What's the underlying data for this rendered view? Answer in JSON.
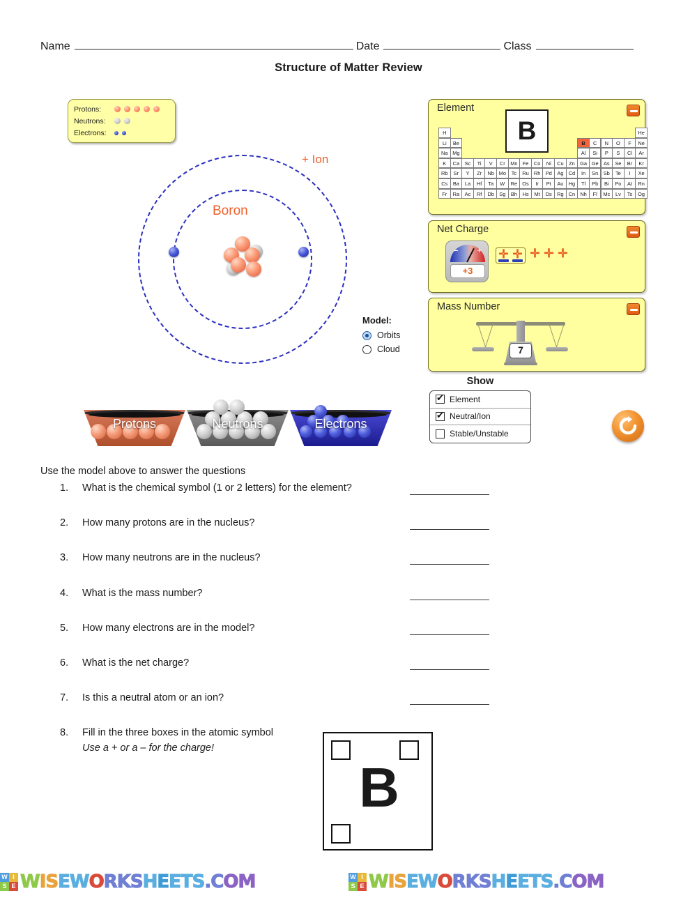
{
  "header": {
    "name_label": "Name",
    "date_label": "Date",
    "class_label": "Class",
    "title": "Structure of Matter Review"
  },
  "legend": {
    "protons_label": "Protons:",
    "neutrons_label": "Neutrons:",
    "electrons_label": "Electrons:",
    "protons_count": 5,
    "neutrons_count": 2,
    "electrons_count": 2
  },
  "atom": {
    "element_name": "Boron",
    "ion_label": "+ Ion",
    "nucleus_protons": 5,
    "nucleus_neutrons": 2,
    "orbit_electrons": 2,
    "accent_color": "#f0612c",
    "orbit_color": "#2b2fbe"
  },
  "model": {
    "title": "Model:",
    "options": [
      {
        "label": "Orbits",
        "selected": true
      },
      {
        "label": "Cloud",
        "selected": false
      }
    ]
  },
  "buckets": [
    {
      "label": "Protons",
      "color": "#c4603c"
    },
    {
      "label": "Neutrons",
      "color": "#6e6e6e"
    },
    {
      "label": "Electrons",
      "color": "#2b2bb4"
    }
  ],
  "panels": {
    "element": {
      "title": "Element",
      "symbol": "B",
      "highlighted": "B",
      "rows": [
        [
          "H",
          "",
          "",
          "",
          "",
          "",
          "",
          "",
          "",
          "",
          "",
          "",
          "",
          "",
          "",
          "",
          "",
          "He"
        ],
        [
          "Li",
          "Be",
          "",
          "",
          "",
          "",
          "",
          "",
          "",
          "",
          "",
          "",
          "B",
          "C",
          "N",
          "O",
          "F",
          "Ne"
        ],
        [
          "Na",
          "Mg",
          "",
          "",
          "",
          "",
          "",
          "",
          "",
          "",
          "",
          "",
          "Al",
          "Si",
          "P",
          "S",
          "Cl",
          "Ar"
        ],
        [
          "K",
          "Ca",
          "Sc",
          "Ti",
          "V",
          "Cr",
          "Mn",
          "Fe",
          "Co",
          "Ni",
          "Cu",
          "Zn",
          "Ga",
          "Ge",
          "As",
          "Se",
          "Br",
          "Kr"
        ],
        [
          "Rb",
          "Sr",
          "Y",
          "Zr",
          "Nb",
          "Mo",
          "Tc",
          "Ru",
          "Rh",
          "Pd",
          "Ag",
          "Cd",
          "In",
          "Sn",
          "Sb",
          "Te",
          "I",
          "Xe"
        ],
        [
          "Cs",
          "Ba",
          "La",
          "Hf",
          "Ta",
          "W",
          "Re",
          "Os",
          "Ir",
          "Pt",
          "Au",
          "Hg",
          "Tl",
          "Pb",
          "Bi",
          "Po",
          "At",
          "Rn"
        ],
        [
          "Fr",
          "Ra",
          "Ac",
          "Rf",
          "Db",
          "Sg",
          "Bh",
          "Hs",
          "Mt",
          "Ds",
          "Rg",
          "Cn",
          "Nh",
          "Fl",
          "Mc",
          "Lv",
          "Ts",
          "Og"
        ]
      ]
    },
    "net_charge": {
      "title": "Net Charge",
      "value": "+3",
      "gauge_minus": "−",
      "gauge_plus": "+",
      "total_plus": 5,
      "paired_plus": 2
    },
    "mass_number": {
      "title": "Mass Number",
      "value": "7"
    }
  },
  "show": {
    "title": "Show",
    "items": [
      {
        "label": "Element",
        "checked": true
      },
      {
        "label": "Neutral/Ion",
        "checked": true
      },
      {
        "label": "Stable/Unstable",
        "checked": false
      }
    ]
  },
  "questions": {
    "intro": "Use the model above to answer the questions",
    "items": [
      {
        "num": "1.",
        "text": "What is the chemical symbol (1 or 2 letters) for the element?"
      },
      {
        "num": "2.",
        "text": "How many protons are in the nucleus?"
      },
      {
        "num": "3.",
        "text": "How many neutrons are in the nucleus?"
      },
      {
        "num": "4.",
        "text": "What is the mass number?"
      },
      {
        "num": "5.",
        "text": "How many electrons are in the model?"
      },
      {
        "num": "6.",
        "text": "What is the net charge?"
      },
      {
        "num": "7.",
        "text": "Is this a neutral atom or an ion?"
      },
      {
        "num": "8.",
        "text": "Fill in the three boxes in the atomic symbol",
        "italic": "Use a + or a – for the charge!"
      }
    ]
  },
  "atomic_symbol": {
    "letter": "B"
  },
  "watermark": {
    "logo_letters": [
      "W",
      "I",
      "S",
      "E"
    ],
    "text": "WISEWORKSHEETS.COM"
  }
}
